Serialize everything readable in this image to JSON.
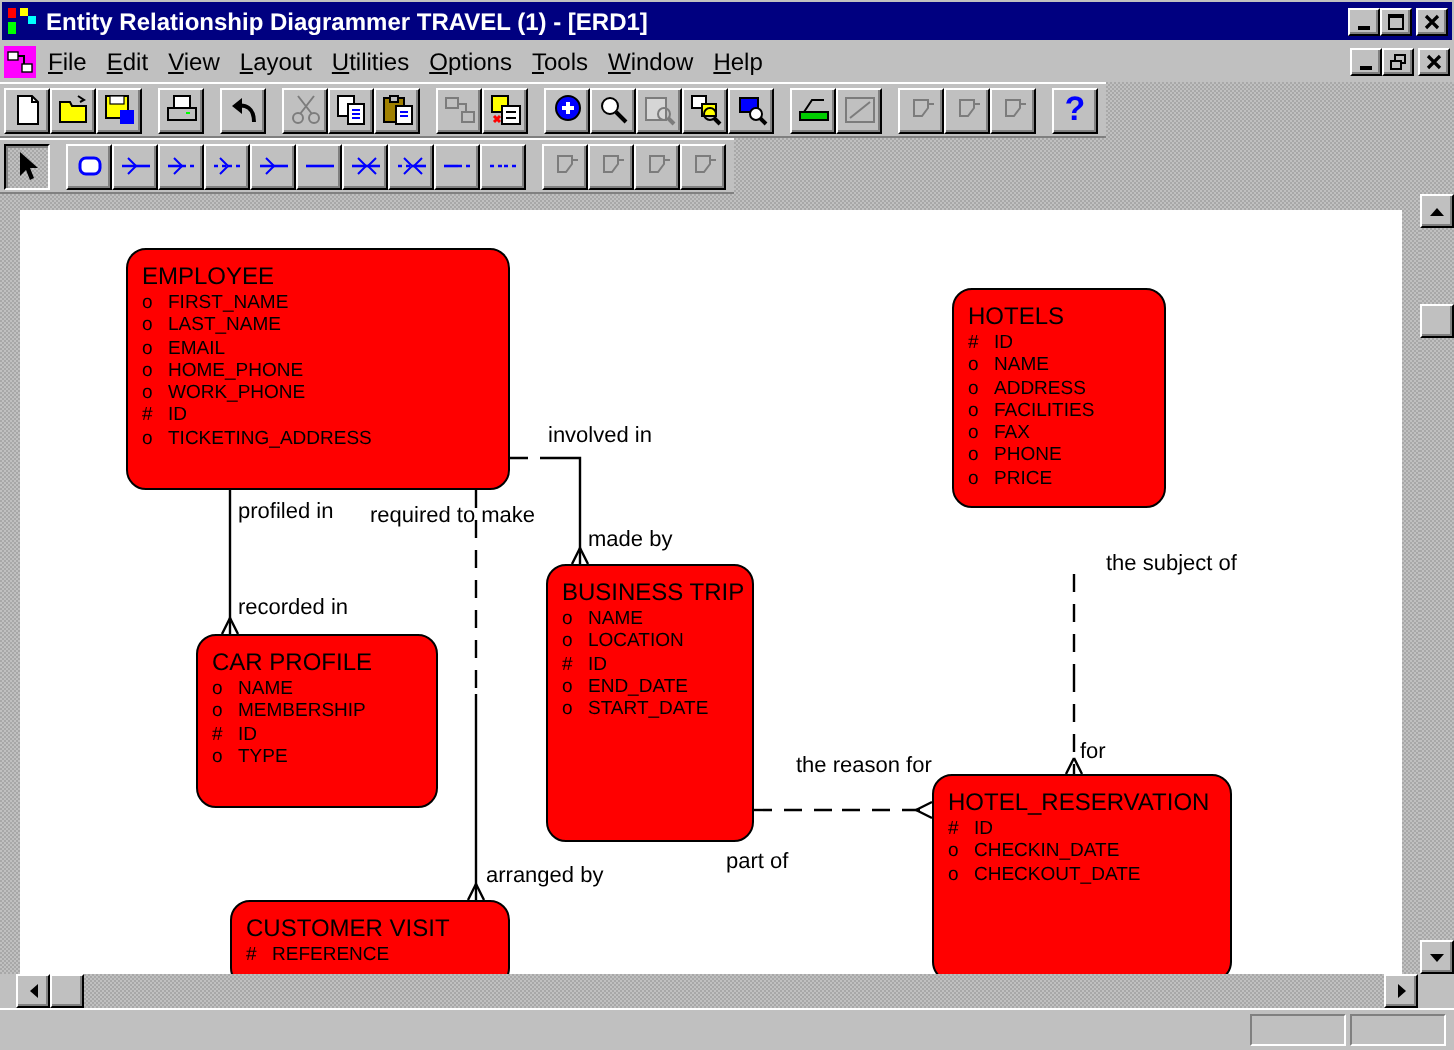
{
  "window": {
    "title": "Entity Relationship Diagrammer TRAVEL (1) - [ERD1]"
  },
  "menu": [
    "File",
    "Edit",
    "View",
    "Layout",
    "Utilities",
    "Options",
    "Tools",
    "Window",
    "Help"
  ],
  "toolbars": [
    {
      "groups": [
        [
          {
            "kind": "new",
            "disabled": false
          },
          {
            "kind": "open",
            "disabled": false
          },
          {
            "kind": "save",
            "disabled": false
          }
        ],
        [
          {
            "kind": "print",
            "disabled": false
          }
        ],
        [
          {
            "kind": "undo",
            "disabled": false
          }
        ],
        [
          {
            "kind": "cut",
            "disabled": true
          },
          {
            "kind": "copy",
            "disabled": false
          },
          {
            "kind": "paste",
            "disabled": false
          }
        ],
        [
          {
            "kind": "group",
            "disabled": true
          },
          {
            "kind": "ungroup",
            "disabled": false
          }
        ],
        [
          {
            "kind": "zoom-in",
            "disabled": false
          },
          {
            "kind": "zoom-out",
            "disabled": false
          },
          {
            "kind": "zoom-fit",
            "disabled": true
          },
          {
            "kind": "zoom-find",
            "disabled": false
          },
          {
            "kind": "zoom-link",
            "disabled": false
          }
        ],
        [
          {
            "kind": "layout",
            "disabled": false
          },
          {
            "kind": "relayout",
            "disabled": true
          }
        ],
        [
          {
            "kind": "tool",
            "disabled": true
          },
          {
            "kind": "tool",
            "disabled": true
          },
          {
            "kind": "tool",
            "disabled": true
          }
        ],
        [
          {
            "kind": "help",
            "label": "?",
            "disabled": false
          }
        ]
      ]
    },
    {
      "groups": [
        [
          {
            "kind": "pointer",
            "selected": true,
            "disabled": false
          }
        ],
        [
          {
            "kind": "entity",
            "selected": false,
            "disabled": false
          },
          {
            "kind": "line-a",
            "selected": false,
            "disabled": false
          },
          {
            "kind": "line-b",
            "selected": false,
            "disabled": false
          },
          {
            "kind": "line-c",
            "selected": false,
            "disabled": false
          },
          {
            "kind": "line-d",
            "selected": false,
            "disabled": false
          },
          {
            "kind": "line-e",
            "selected": false,
            "disabled": false
          },
          {
            "kind": "line-f",
            "selected": false,
            "disabled": false
          },
          {
            "kind": "line-g",
            "selected": false,
            "disabled": false
          },
          {
            "kind": "line-h",
            "selected": false,
            "disabled": false
          },
          {
            "kind": "line-i",
            "selected": false,
            "disabled": false
          }
        ],
        [
          {
            "kind": "tool",
            "selected": false,
            "disabled": true
          },
          {
            "kind": "tool",
            "selected": false,
            "disabled": true
          },
          {
            "kind": "tool",
            "selected": false,
            "disabled": true
          },
          {
            "kind": "tool",
            "selected": false,
            "disabled": true
          }
        ]
      ]
    }
  ],
  "diagram": {
    "entities": [
      {
        "name": "EMPLOYEE",
        "attributes": [
          {
            "marker": "o",
            "name": "FIRST_NAME"
          },
          {
            "marker": "o",
            "name": "LAST_NAME"
          },
          {
            "marker": "o",
            "name": "EMAIL"
          },
          {
            "marker": "o",
            "name": "HOME_PHONE"
          },
          {
            "marker": "o",
            "name": "WORK_PHONE"
          },
          {
            "marker": "#",
            "name": "ID"
          },
          {
            "marker": "o",
            "name": "TICKETING_ADDRESS"
          }
        ]
      },
      {
        "name": "HOTELS",
        "attributes": [
          {
            "marker": "#",
            "name": "ID"
          },
          {
            "marker": "o",
            "name": "NAME"
          },
          {
            "marker": "o",
            "name": "ADDRESS"
          },
          {
            "marker": "o",
            "name": "FACILITIES"
          },
          {
            "marker": "o",
            "name": "FAX"
          },
          {
            "marker": "o",
            "name": "PHONE"
          },
          {
            "marker": "o",
            "name": "PRICE"
          }
        ]
      },
      {
        "name": "CAR PROFILE",
        "attributes": [
          {
            "marker": "o",
            "name": "NAME"
          },
          {
            "marker": "o",
            "name": "MEMBERSHIP"
          },
          {
            "marker": "#",
            "name": "ID"
          },
          {
            "marker": "o",
            "name": "TYPE"
          }
        ]
      },
      {
        "name": "BUSINESS TRIP",
        "attributes": [
          {
            "marker": "o",
            "name": "NAME"
          },
          {
            "marker": "o",
            "name": "LOCATION"
          },
          {
            "marker": "#",
            "name": "ID"
          },
          {
            "marker": "o",
            "name": "END_DATE"
          },
          {
            "marker": "o",
            "name": "START_DATE"
          }
        ]
      },
      {
        "name": "HOTEL_RESERVATION",
        "attributes": [
          {
            "marker": "#",
            "name": "ID"
          },
          {
            "marker": "o",
            "name": "CHECKIN_DATE"
          },
          {
            "marker": "o",
            "name": "CHECKOUT_DATE"
          }
        ]
      },
      {
        "name": "CUSTOMER VISIT",
        "attributes": [
          {
            "marker": "#",
            "name": "REFERENCE"
          }
        ]
      }
    ],
    "relationships": [
      {
        "from_label": "profiled in",
        "to_label": "recorded in",
        "from_optional": false,
        "to_optional": false,
        "to_many": true
      },
      {
        "from_label": "involved in",
        "to_label": "made by",
        "from_optional": true,
        "to_optional": false,
        "to_many": true
      },
      {
        "from_label": "required to make",
        "to_label": "arranged by",
        "from_optional": true,
        "to_optional": false,
        "to_many": true
      },
      {
        "from_label": "part of",
        "to_label": "the reason for",
        "from_optional": true,
        "to_optional": true,
        "to_many": true
      },
      {
        "from_label": "the subject of",
        "to_label": "for",
        "from_optional": true,
        "to_optional": true,
        "to_many": true
      }
    ]
  }
}
